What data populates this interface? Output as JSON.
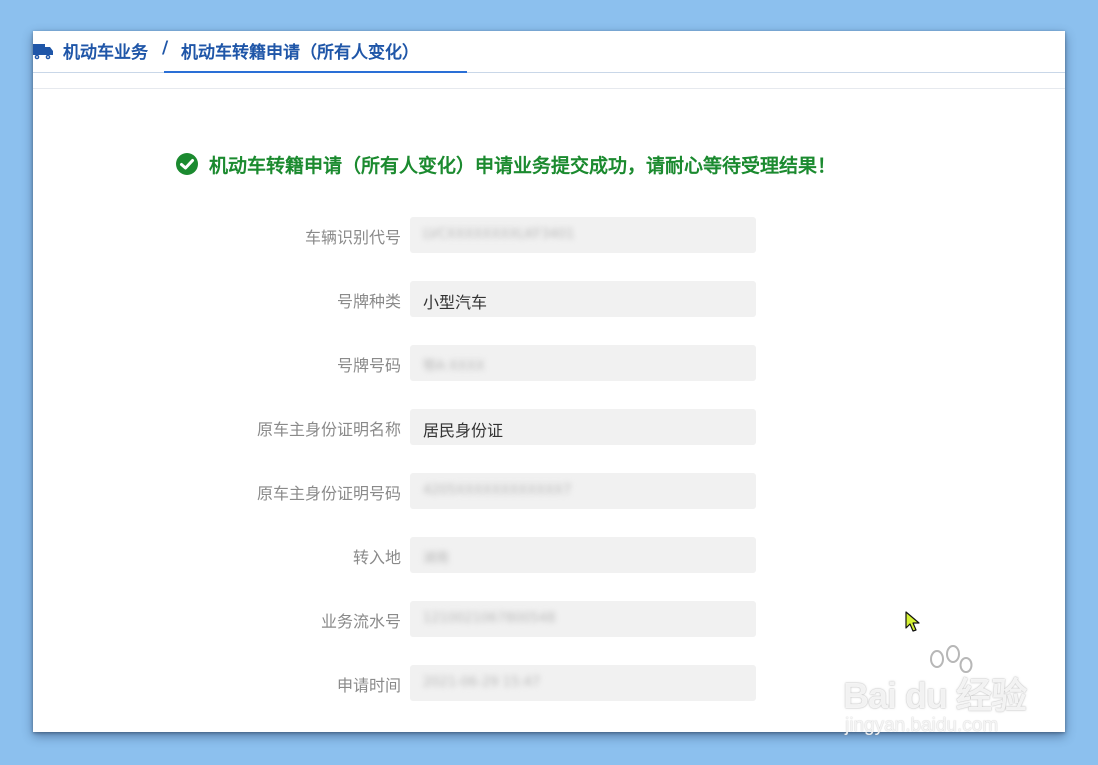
{
  "breadcrumb": {
    "parent": "机动车业务",
    "separator": "/",
    "current": "机动车转籍申请（所有人变化）"
  },
  "success_message": "机动车转籍申请（所有人变化）申请业务提交成功，请耐心等待受理结果！",
  "fields": [
    {
      "label": "车辆识别代号",
      "value": "LVCXXXXXXXXLKF3401",
      "blurred": true
    },
    {
      "label": "号牌种类",
      "value": "小型汽车",
      "blurred": false
    },
    {
      "label": "号牌号码",
      "value": "鄂A·XXXX",
      "blurred": true
    },
    {
      "label": "原车主身份证明名称",
      "value": "居民身份证",
      "blurred": false
    },
    {
      "label": "原车主身份证明号码",
      "value": "4205XXXXXXXXXXXX7",
      "blurred": true
    },
    {
      "label": "转入地",
      "value": "湖南",
      "blurred": true
    },
    {
      "label": "业务流水号",
      "value": "1210021067800548",
      "blurred": true
    },
    {
      "label": "申请时间",
      "value": "2021-06-29 15:47",
      "blurred": true
    }
  ],
  "watermark": {
    "logo_text": "Bai du 经验",
    "url": "jingyan.baidu.com"
  },
  "colors": {
    "background": "#8cc0ee",
    "breadcrumb": "#1f56a8",
    "success": "#1b8a2f",
    "field_bg": "#f1f1f1"
  }
}
